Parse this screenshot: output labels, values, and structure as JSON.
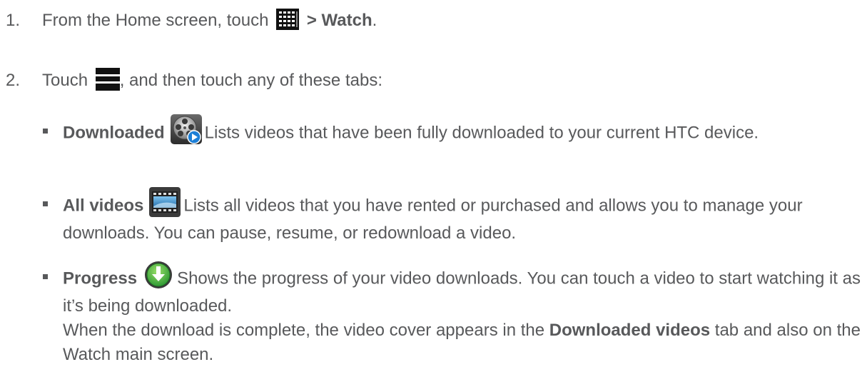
{
  "steps": [
    {
      "number": "1.",
      "text_before": "From the Home screen, touch ",
      "icon": "apps-grid-icon",
      "bold_text": "> Watch",
      "text_after": "."
    },
    {
      "number": "2.",
      "text_before": "Touch ",
      "icon": "menu-icon",
      "text_after": ", and then touch any of these tabs:"
    }
  ],
  "tabs": [
    {
      "label": "Downloaded",
      "icon": "film-reel-play-icon",
      "description": "Lists videos that have been fully downloaded to your current HTC device."
    },
    {
      "label": "All videos",
      "icon": "video-library-icon",
      "description": "Lists all videos that you have rented or purchased and allows you to manage your downloads. You can pause, resume, or redownload a video."
    },
    {
      "label": "Progress",
      "icon": "green-download-icon",
      "description": "Shows the progress of your video downloads. You can touch a video to start watching it as it’s being downloaded.",
      "note_before": "When the download is complete, the video cover appears in the ",
      "note_bold": "Downloaded videos",
      "note_after": " tab and also on the Watch main screen."
    }
  ],
  "colors": {
    "text": "#58595b",
    "icon_dark": "#111111",
    "progress_green": "#3bb44a"
  }
}
